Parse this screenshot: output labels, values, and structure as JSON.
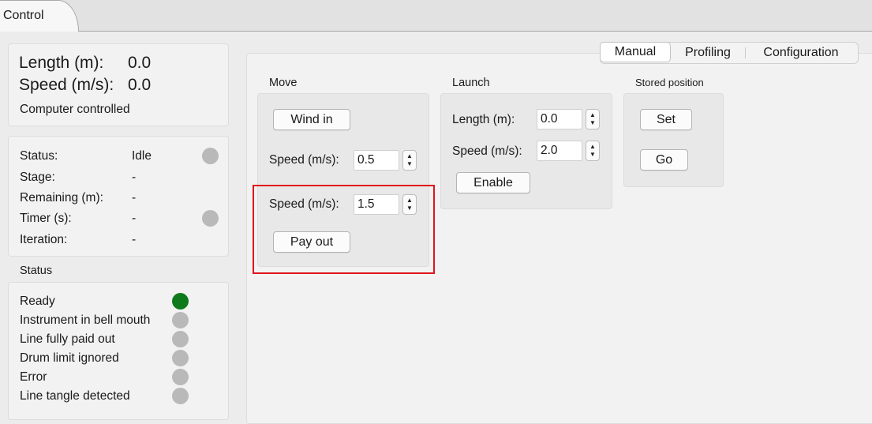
{
  "tabs": {
    "control": "Control"
  },
  "readout": {
    "length_label": "Length (m):",
    "length_value": "0.0",
    "speed_label": "Speed (m/s):",
    "speed_value": "0.0",
    "mode": "Computer controlled"
  },
  "state": {
    "status_label": "Status:",
    "status_value": "Idle",
    "stage_label": "Stage:",
    "stage_value": "-",
    "remaining_label": "Remaining (m):",
    "remaining_value": "-",
    "timer_label": "Timer (s):",
    "timer_value": "-",
    "iteration_label": "Iteration:",
    "iteration_value": "-"
  },
  "status_section": {
    "title": "Status",
    "items": [
      {
        "label": "Ready",
        "color": "#0f7a1b"
      },
      {
        "label": "Instrument in bell mouth",
        "color": "#b9b9b9"
      },
      {
        "label": "Line fully paid out",
        "color": "#b9b9b9"
      },
      {
        "label": "Drum limit ignored",
        "color": "#b9b9b9"
      },
      {
        "label": "Error",
        "color": "#b9b9b9"
      },
      {
        "label": "Line tangle detected",
        "color": "#b9b9b9"
      }
    ]
  },
  "mode_tabs": {
    "manual": "Manual",
    "profiling": "Profiling",
    "configuration": "Configuration",
    "selected": "Manual"
  },
  "move": {
    "title": "Move",
    "wind_in_button": "Wind in",
    "wind_in_speed_label": "Speed (m/s):",
    "wind_in_speed_value": "0.5",
    "pay_out_speed_label": "Speed (m/s):",
    "pay_out_speed_value": "1.5",
    "pay_out_button": "Pay out"
  },
  "launch": {
    "title": "Launch",
    "length_label": "Length (m):",
    "length_value": "0.0",
    "speed_label": "Speed (m/s):",
    "speed_value": "2.0",
    "enable_button": "Enable"
  },
  "stored_position": {
    "title": "Stored position",
    "set_button": "Set",
    "go_button": "Go"
  },
  "colors": {
    "highlight": "#e0141c",
    "ready_indicator": "#0f7a1b",
    "inactive_indicator": "#b9b9b9"
  }
}
